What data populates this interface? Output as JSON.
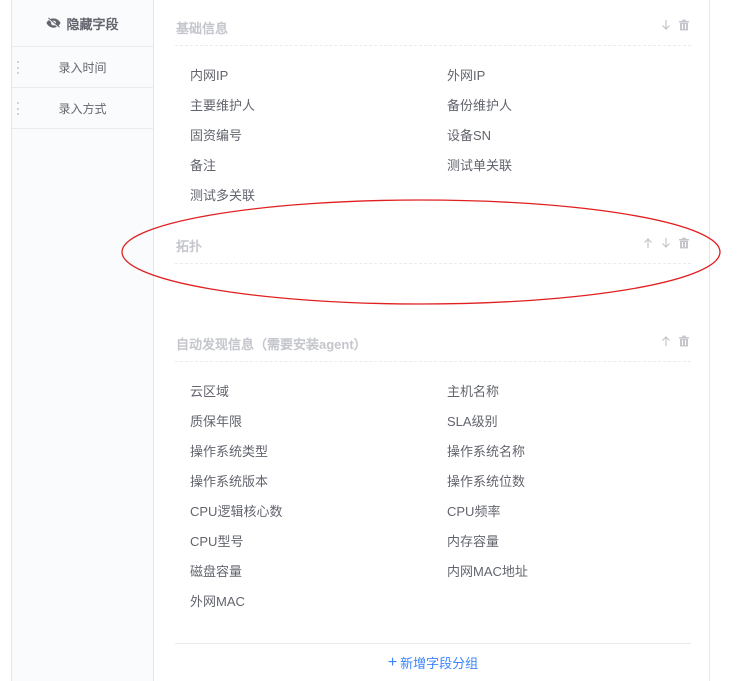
{
  "sidebar": {
    "title": "隐藏字段",
    "items": [
      {
        "label": "录入时间"
      },
      {
        "label": "录入方式"
      }
    ]
  },
  "groups": [
    {
      "title": "基础信息",
      "fields": [
        "内网IP",
        "外网IP",
        "主要维护人",
        "备份维护人",
        "固资编号",
        "设备SN",
        "备注",
        "测试单关联",
        "测试多关联"
      ]
    },
    {
      "title": "拓扑",
      "fields": []
    },
    {
      "title": "自动发现信息（需要安装agent）",
      "fields": [
        "云区域",
        "主机名称",
        "质保年限",
        "SLA级别",
        "操作系统类型",
        "操作系统名称",
        "操作系统版本",
        "操作系统位数",
        "CPU逻辑核心数",
        "CPU频率",
        "CPU型号",
        "内存容量",
        "磁盘容量",
        "内网MAC地址",
        "外网MAC"
      ]
    }
  ],
  "add_group_label": "新增字段分组",
  "colors": {
    "accent": "#3a84ff",
    "annotation": "#e02020",
    "muted": "#c4c6cc",
    "text": "#63656e"
  }
}
